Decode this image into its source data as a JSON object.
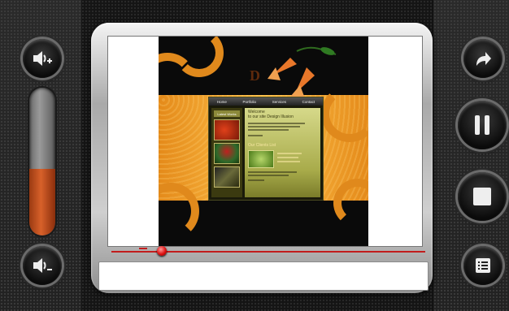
{
  "player": {
    "volume_level_percent": 45,
    "playback_position_percent": 16,
    "caption_text": ""
  },
  "controls": {
    "left": [
      {
        "name": "volume-up",
        "icon": "volume-up-icon"
      },
      {
        "name": "volume-down",
        "icon": "volume-down-icon"
      }
    ],
    "right": [
      {
        "name": "replay",
        "icon": "redo-arrow-icon"
      },
      {
        "name": "pause",
        "icon": "pause-icon"
      },
      {
        "name": "stop",
        "icon": "stop-icon"
      },
      {
        "name": "menu",
        "icon": "list-icon"
      }
    ]
  },
  "website": {
    "nav": [
      "Home",
      "Portfolio",
      "Services",
      "Contact"
    ],
    "latest_work": "Latest Works",
    "welcome_line1": "Welcome",
    "welcome_line2": "to our site Design Illusion",
    "clients_heading": "Our Clients List",
    "logo_fragment": "D"
  },
  "colors": {
    "accent_red": "#c21d1d",
    "meter_orange": "#d8612a",
    "site_orange": "#e48a1a"
  }
}
